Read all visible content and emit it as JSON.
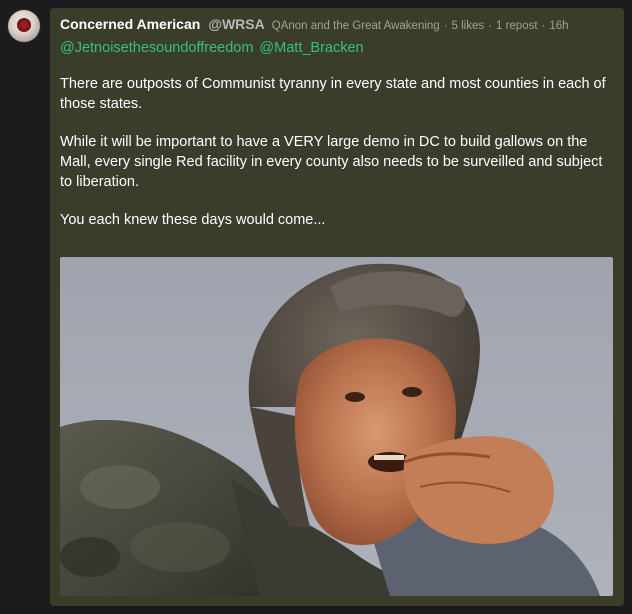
{
  "post": {
    "author": "Concerned American",
    "handle": "@WRSA",
    "group": "QAnon and the Great Awakening",
    "likes": "5 likes",
    "reposts": "1 repost",
    "time": "16h",
    "mentions": [
      "@Jetnoisethesoundoffreedom",
      "@Matt_Bracken"
    ],
    "paragraphs": [
      "There are outposts of Communist tyranny in every state and most counties in each of those states.",
      "While it will be important to have a VERY large demo in DC to build gallows on the Mall, every single Red facility in every county also needs to be surveilled and subject to liberation.",
      "You each knew these days would come..."
    ]
  },
  "colors": {
    "card_background": "#3a3d2a",
    "page_background": "#1c1c1e",
    "mention_color": "#34c27a",
    "meta_color": "#a2a294"
  },
  "separator": "·"
}
